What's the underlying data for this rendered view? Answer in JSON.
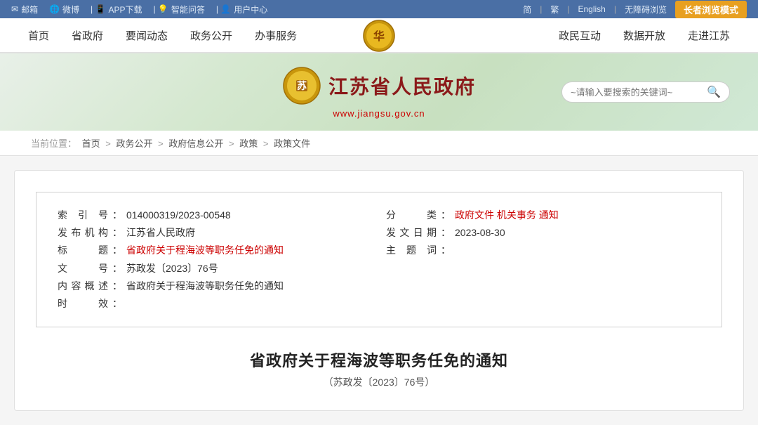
{
  "topbar": {
    "left_items": [
      {
        "icon": "✉",
        "label": "邮箱"
      },
      {
        "icon": "🌐",
        "label": "微博"
      },
      {
        "icon": "📱",
        "label": "APP下载"
      },
      {
        "icon": "💡",
        "label": "智能问答"
      },
      {
        "icon": "👤",
        "label": "用户中心"
      }
    ],
    "right_items": [
      {
        "label": "简"
      },
      {
        "label": "繁"
      },
      {
        "label": "English"
      },
      {
        "label": "无障碍浏览"
      }
    ],
    "senior_btn": "长者浏览模式"
  },
  "nav": {
    "left_items": [
      "首页",
      "省政府",
      "要闻动态",
      "政务公开",
      "办事服务"
    ],
    "right_items": [
      "政民互动",
      "数据开放",
      "走进江苏"
    ]
  },
  "logo": {
    "title": "江苏省人民政府",
    "url_prefix": "www.",
    "url_main": "jiangsu",
    "url_suffix": ".gov.cn",
    "search_placeholder": "~请输入要搜索的关键词~"
  },
  "breadcrumb": {
    "label": "当前位置：",
    "items": [
      "首页",
      "政务公开",
      "政府信息公开",
      "政策",
      "政策文件"
    ]
  },
  "document": {
    "index_label": "索 引 号",
    "index_value": "014000319/2023-00548",
    "category_label": "分　　类",
    "category_value": "政府文件 机关事务 通知",
    "issuer_label": "发布机构",
    "issuer_value": "江苏省人民政府",
    "issue_date_label": "发文日期",
    "issue_date_value": "2023-08-30",
    "title_label": "标　　题",
    "title_value": "省政府关于程海波等职务任免的通知",
    "subject_label": "主 题 词",
    "subject_value": "",
    "doc_num_label": "文　　号",
    "doc_num_value": "苏政发〔2023〕76号",
    "summary_label": "内容概述",
    "summary_value": "省政府关于程海波等职务任免的通知",
    "validity_label": "时　　效",
    "validity_value": "",
    "main_title": "省政府关于程海波等职务任免的通知",
    "sub_title": "（苏政发〔2023〕76号）"
  }
}
